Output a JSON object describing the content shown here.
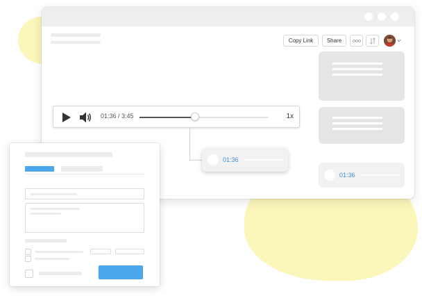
{
  "toolbar": {
    "copy_link_label": "Copy Link",
    "share_label": "Share",
    "more_icon": "more-icon",
    "sort_icon": "sort-icon"
  },
  "player": {
    "play_icon": "play-icon",
    "volume_icon": "volume-icon",
    "time_display": "01:36 / 3:45",
    "speed": "1x",
    "progress": 0.43
  },
  "comments": {
    "pinned_timestamp": "01:36",
    "sidebar_timestamp": "01:36"
  },
  "colors": {
    "accent_blue": "#4aa7ec",
    "timestamp_blue": "#3c8fd6",
    "highlight_yellow": "#fbf6b9"
  }
}
